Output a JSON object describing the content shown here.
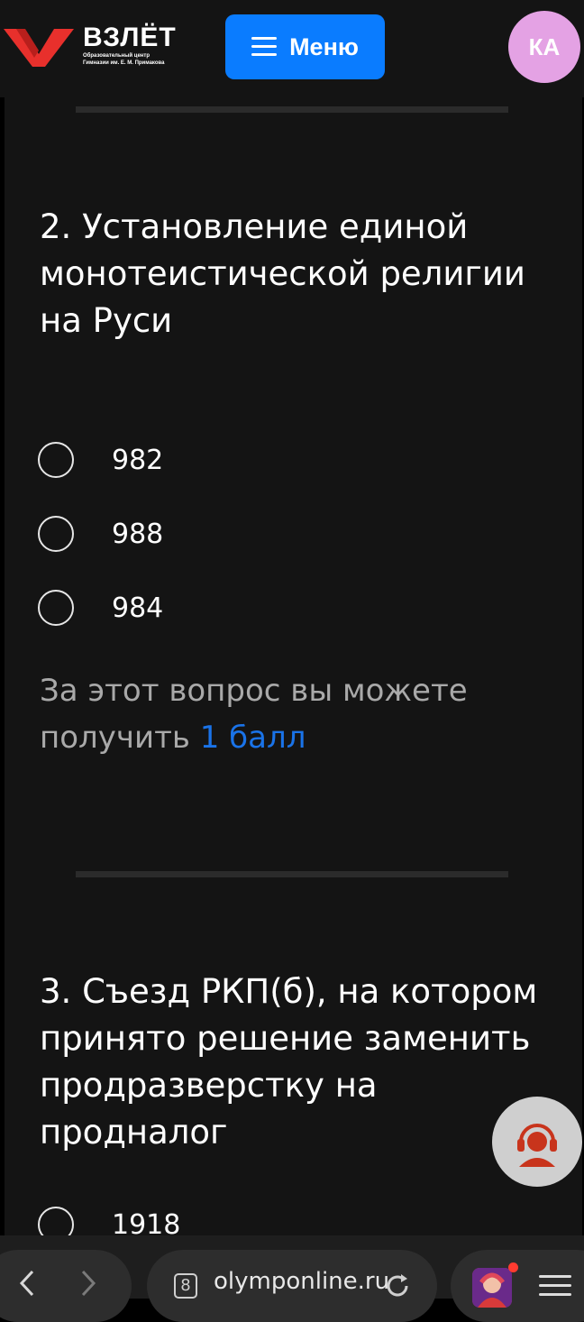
{
  "header": {
    "logo_title": "ВЗЛЁТ",
    "logo_sub_line1": "Образовательный центр",
    "logo_sub_line2": "Гимназии им. Е. М. Примакова",
    "menu_label": "Меню",
    "avatar_initials": "КА"
  },
  "questions": [
    {
      "text": "2. Установление единой монотеистической религии на Руси",
      "options": [
        "982",
        "988",
        "984"
      ],
      "points_prefix": "За этот вопрос вы можете получить",
      "points_value": "1 балл"
    },
    {
      "text": "3. Съезд РКП(б), на котором принято решение заменить продразверстку на продналог",
      "options": [
        "1918"
      ]
    }
  ],
  "browser": {
    "tab_count": "8",
    "url": "olymponline.ru"
  },
  "colors": {
    "accent": "#0a7cff",
    "points_link": "#1a73e8",
    "avatar_bg": "#e4a2e4",
    "logo_red": "#e8302c"
  }
}
